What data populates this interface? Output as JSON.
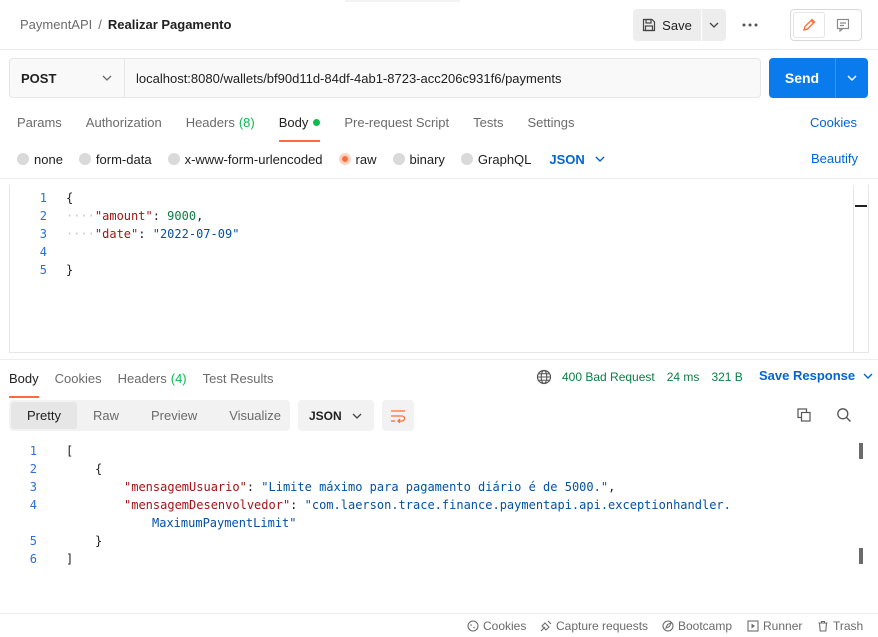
{
  "header": {
    "breadcrumb_parent": "PaymentAPI",
    "breadcrumb_separator": "/",
    "breadcrumb_current": "Realizar Pagamento",
    "save_label": "Save",
    "more_icon": "more-horizontal-icon"
  },
  "request": {
    "method": "POST",
    "url": "localhost:8080/wallets/bf90d11d-84df-4ab1-8723-acc206c931f6/payments",
    "send_label": "Send",
    "tabs": [
      {
        "label": "Params"
      },
      {
        "label": "Authorization"
      },
      {
        "label": "Headers",
        "count": "(8)"
      },
      {
        "label": "Body",
        "active": true
      },
      {
        "label": "Pre-request Script"
      },
      {
        "label": "Tests"
      },
      {
        "label": "Settings"
      }
    ],
    "cookies_label": "Cookies",
    "body_types": [
      {
        "label": "none"
      },
      {
        "label": "form-data"
      },
      {
        "label": "x-www-form-urlencoded"
      },
      {
        "label": "raw",
        "selected": true
      },
      {
        "label": "binary"
      },
      {
        "label": "GraphQL"
      }
    ],
    "body_format": "JSON",
    "beautify_label": "Beautify",
    "body_lines": [
      {
        "n": "1",
        "open": "{"
      },
      {
        "n": "2",
        "key": "\"amount\"",
        "sep": ": ",
        "value": "9000",
        "tail": ","
      },
      {
        "n": "3",
        "key": "\"date\"",
        "sep": ": ",
        "value": "\"2022-07-09\"",
        "tail": ""
      },
      {
        "n": "4"
      },
      {
        "n": "5",
        "close": "}"
      }
    ]
  },
  "response": {
    "tabs": [
      {
        "label": "Body",
        "active": true
      },
      {
        "label": "Cookies"
      },
      {
        "label": "Headers",
        "count": "(4)"
      },
      {
        "label": "Test Results"
      }
    ],
    "status": "400 Bad Request",
    "time": "24 ms",
    "size": "321 B",
    "save_response_label": "Save Response",
    "view_tabs": [
      "Pretty",
      "Raw",
      "Preview",
      "Visualize"
    ],
    "format": "JSON",
    "lines": [
      {
        "n": "1",
        "text": "["
      },
      {
        "n": "2",
        "text": "{"
      },
      {
        "n": "3",
        "key": "\"mensagemUsuario\"",
        "value": "\"Limite máximo para pagamento diário é de 5000.\"",
        "tail": ","
      },
      {
        "n": "4",
        "key": "\"mensagemDesenvolvedor\"",
        "value": "\"com.laerson.trace.finance.paymentapi.api.exceptionhandler.",
        "cont": "MaximumPaymentLimit\""
      },
      {
        "n": "5",
        "text": "}"
      },
      {
        "n": "6",
        "text": "]"
      }
    ]
  },
  "footer": {
    "cookies": "Cookies",
    "capture": "Capture requests",
    "bootcamp": "Bootcamp",
    "runner": "Runner",
    "trash": "Trash"
  },
  "colors": {
    "accent": "#ff6c37",
    "send_blue": "#097bed",
    "link_blue": "#0265d2",
    "success_green": "#0cbb52",
    "status_green": "#0b7d45"
  }
}
